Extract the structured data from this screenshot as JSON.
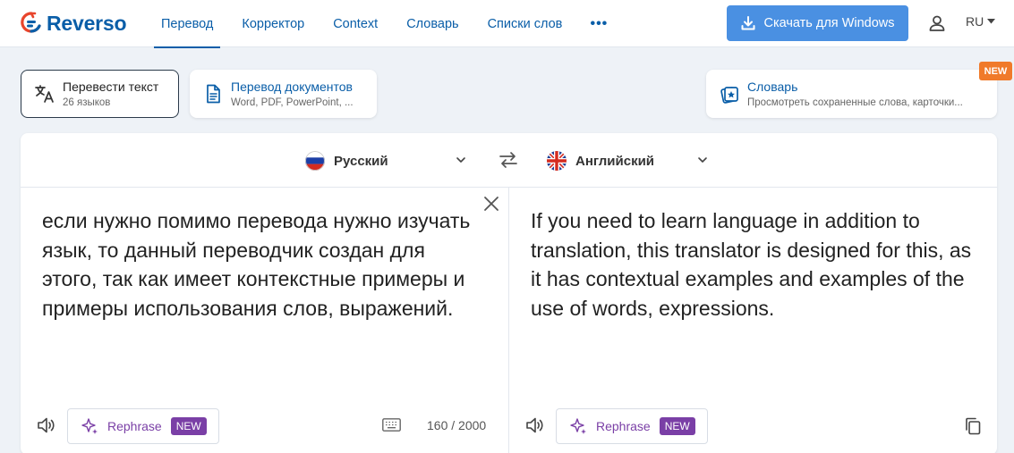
{
  "header": {
    "logo_text": "Reverso",
    "nav": [
      {
        "label": "Перевод",
        "active": true
      },
      {
        "label": "Корректор",
        "active": false
      },
      {
        "label": "Context",
        "active": false
      },
      {
        "label": "Словарь",
        "active": false
      },
      {
        "label": "Списки слов",
        "active": false
      }
    ],
    "more_label": "•••",
    "download_label": "Скачать для Windows",
    "user_icon": "user-icon",
    "language": "RU"
  },
  "modes": {
    "translate": {
      "title": "Перевести текст",
      "subtitle": "26 языков",
      "icon": "translate-icon"
    },
    "documents": {
      "title": "Перевод документов",
      "subtitle": "Word, PDF, PowerPoint, ...",
      "icon": "document-icon"
    },
    "dictionary": {
      "title": "Словарь",
      "subtitle": "Просмотреть сохраненные слова, карточки...",
      "icon": "flashcards-icon",
      "badge": "NEW"
    }
  },
  "translator": {
    "source_lang": "Русский",
    "target_lang": "Английский",
    "source_text": "если нужно помимо перевода нужно изучать язык, то данный переводчик создан для этого, так как имеет контекстные примеры и примеры использования слов, выражений.",
    "target_text": "If you need to learn language in addition to translation, this translator is designed for this, as it has contextual examples and examples of the use of words, expressions.",
    "rephrase_label": "Rephrase",
    "rephrase_badge": "NEW",
    "char_count": "160 / 2000"
  },
  "colors": {
    "brand": "#0a5ea8",
    "download_button": "#4a90e2",
    "rephrase": "#7a3fa6",
    "new_corner_badge": "#f07a2a"
  }
}
